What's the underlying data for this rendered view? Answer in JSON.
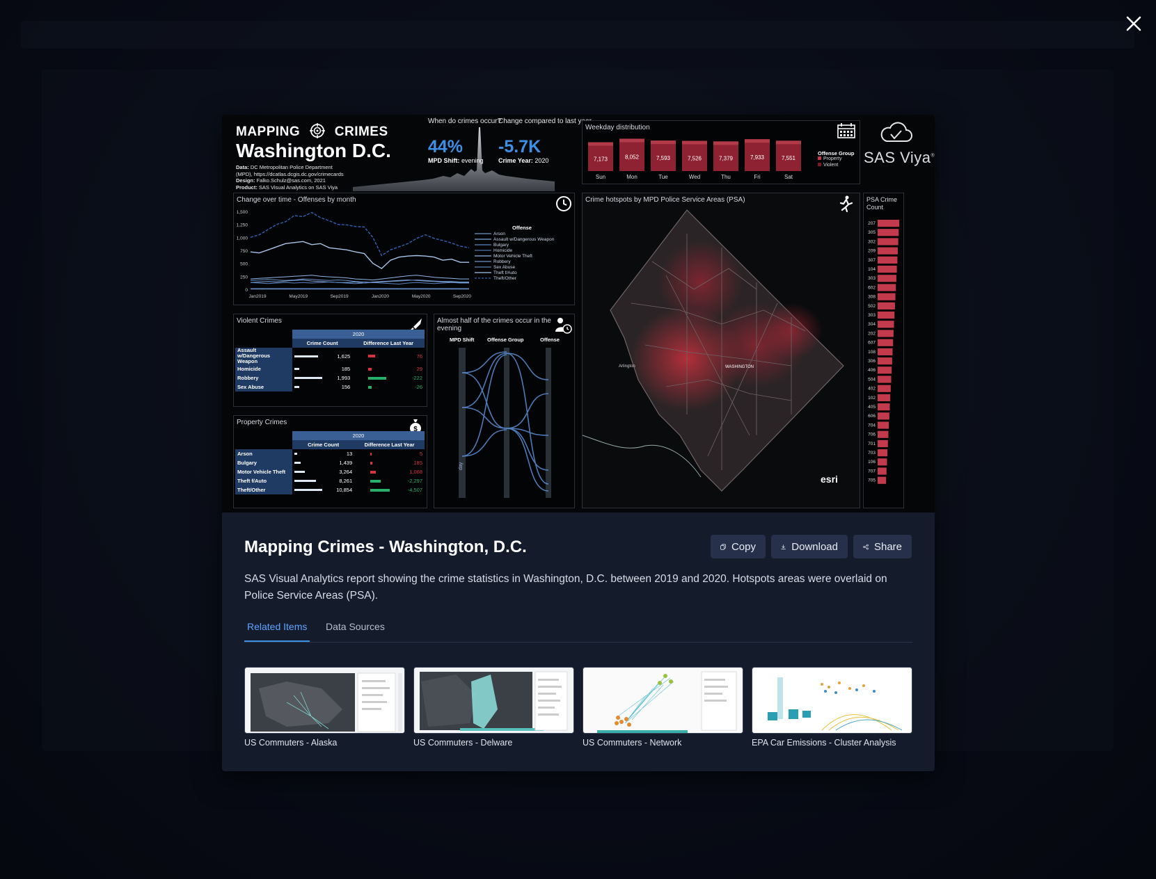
{
  "close": {
    "icon": "close-icon"
  },
  "modal": {
    "title": "Mapping Crimes - Washington, D.C.",
    "description": "SAS Visual Analytics report showing the crime statistics in Washington, D.C. between 2019 and 2020. Hotspots areas were overlaid on Police Service Areas (PSA).",
    "buttons": {
      "copy": "Copy",
      "download": "Download",
      "share": "Share"
    },
    "tabs": [
      {
        "label": "Related Items",
        "active": true
      },
      {
        "label": "Data Sources",
        "active": false
      }
    ],
    "related": [
      {
        "label": "US Commuters - Alaska"
      },
      {
        "label": "US Commuters - Delware"
      },
      {
        "label": "US Commuters - Network"
      },
      {
        "label": "EPA Car Emissions - Cluster Analysis"
      }
    ]
  },
  "dashboard": {
    "header": {
      "mapping": "MAPPING",
      "crimes": "CRIMES",
      "city": "Washington D.C.",
      "info": [
        {
          "label": "Data:",
          "text": " DC Metropolitan Police Department"
        },
        {
          "label": "",
          "text": "(MPD), https://dcatlas.dcgis.dc.gov/crimecards"
        },
        {
          "label": "Design:",
          "text": " Falko.Schulz@sas.com, 2021"
        },
        {
          "label": "Product:",
          "text": " SAS Visual Analytics on SAS Viya"
        }
      ]
    },
    "kpi1": {
      "question": "When do crimes\noccur?",
      "value": "44%",
      "sub_label": "MPD Shift:",
      "sub_value": "evening"
    },
    "kpi2": {
      "question": "Change compared to\nlast year",
      "value": "-5.7K",
      "sub_label": "Crime Year:",
      "sub_value": "2020"
    },
    "weekday": {
      "title": "Weekday distribution",
      "legend_title": "Offense Group",
      "legend": [
        "Property",
        "Violent"
      ]
    },
    "brand": "SAS Viya",
    "brand_mark": "®",
    "change_over_time": {
      "title": "Change over time - Offenses by month"
    },
    "violent": {
      "title": "Violent Crimes",
      "year": "2020",
      "col1": "Crime Count",
      "col2": "Difference Last Year",
      "rows": [
        {
          "name": "Assault w/Dangerous Weapon",
          "count": "1,625",
          "diff": "76",
          "count_frac": 0.82,
          "diff_frac": 0.3,
          "positive": false
        },
        {
          "name": "Homicide",
          "count": "185",
          "diff": "29",
          "count_frac": 0.09,
          "diff_frac": 0.12,
          "positive": false
        },
        {
          "name": "Robbery",
          "count": "1,993",
          "diff": "-222",
          "count_frac": 1.0,
          "diff_frac": 0.9,
          "positive": true
        },
        {
          "name": "Sex Abuse",
          "count": "156",
          "diff": "-26",
          "count_frac": 0.08,
          "diff_frac": 0.11,
          "positive": true
        }
      ]
    },
    "property": {
      "title": "Property Crimes",
      "year": "2020",
      "col1": "Crime Count",
      "col2": "Difference Last Year",
      "rows": [
        {
          "name": "Arson",
          "count": "13",
          "diff": "5",
          "count_frac": 0.01,
          "diff_frac": 0.01,
          "positive": false
        },
        {
          "name": "Bulgary",
          "count": "1,439",
          "diff": "185",
          "count_frac": 0.13,
          "diff_frac": 0.04,
          "positive": false
        },
        {
          "name": "Motor Vehicle Theft",
          "count": "3,264",
          "diff": "1,068",
          "count_frac": 0.3,
          "diff_frac": 0.23,
          "positive": false
        },
        {
          "name": "Theft f/Auto",
          "count": "8,261",
          "diff": "-2,297",
          "count_frac": 0.76,
          "diff_frac": 0.5,
          "positive": true
        },
        {
          "name": "Theft/Other",
          "count": "10,854",
          "diff": "-4,507",
          "count_frac": 1.0,
          "diff_frac": 0.98,
          "positive": true
        }
      ]
    },
    "parallel": {
      "title": "Almost half of the crimes occur in the\nevening",
      "axes": [
        "MPD Shift",
        "Offense Group",
        "Offense"
      ],
      "axis_label": "day"
    },
    "map": {
      "title": "Crime hotspots by MPD Police Service Areas (PSA)",
      "credit": "esri",
      "city_label": "WASHINGTON",
      "arlington": "Arlington"
    },
    "psa": {
      "title": "PSA Crime\nCount"
    }
  },
  "chart_data": [
    {
      "type": "bar",
      "title": "Weekday distribution",
      "categories": [
        "Sun",
        "Mon",
        "Tue",
        "Wed",
        "Thu",
        "Fri",
        "Sat"
      ],
      "series": [
        {
          "name": "Property",
          "values": [
            7173,
            8052,
            7593,
            7526,
            7379,
            7933,
            7551
          ]
        }
      ],
      "value_labels": [
        "7,173",
        "8,052",
        "7,593",
        "7,526",
        "7,379",
        "7,933",
        "7,551"
      ]
    },
    {
      "type": "line",
      "title": "Change over time - Offenses by month",
      "x": [
        "Jan2019",
        "May2019",
        "Sep2019",
        "Jan2020",
        "May2020",
        "Sep2020"
      ],
      "yticks": [
        "0",
        "250",
        "500",
        "750",
        "1,000",
        "1,250",
        "1,500"
      ],
      "ylim": [
        0,
        1500
      ],
      "legend_title": "Offense",
      "series": [
        {
          "name": "Arson",
          "values": [
            3,
            3,
            3,
            3,
            3,
            3,
            3,
            3,
            3,
            3,
            3,
            3,
            3,
            3,
            3,
            3,
            3,
            3,
            3,
            3,
            3,
            3,
            3,
            3,
            3,
            3
          ],
          "style": "solid"
        },
        {
          "name": "Assault w/Dangerous Weapon",
          "values": [
            130,
            140,
            150,
            140,
            160,
            170,
            180,
            160,
            150,
            140,
            130,
            130,
            140,
            120,
            140,
            150,
            160,
            170,
            180,
            170,
            160,
            150,
            140,
            140,
            130,
            130
          ],
          "style": "solid"
        },
        {
          "name": "Bulgary",
          "values": [
            130,
            120,
            110,
            120,
            130,
            120,
            130,
            120,
            130,
            140,
            130,
            120,
            110,
            120,
            130,
            120,
            110,
            100,
            120,
            130,
            120,
            110,
            120,
            130,
            120,
            120
          ],
          "style": "solid"
        },
        {
          "name": "Homicide",
          "values": [
            15,
            15,
            15,
            15,
            15,
            15,
            15,
            15,
            15,
            15,
            15,
            15,
            15,
            15,
            15,
            15,
            15,
            15,
            15,
            15,
            15,
            15,
            15,
            15,
            15,
            15
          ],
          "style": "solid"
        },
        {
          "name": "Motor Vehicle Theft",
          "values": [
            200,
            210,
            220,
            230,
            240,
            250,
            260,
            270,
            250,
            240,
            230,
            220,
            200,
            190,
            180,
            200,
            220,
            240,
            260,
            270,
            250,
            230,
            220,
            210,
            200,
            200
          ],
          "style": "solid"
        },
        {
          "name": "Robbery",
          "values": [
            170,
            180,
            190,
            180,
            170,
            180,
            200,
            190,
            180,
            170,
            180,
            170,
            150,
            140,
            130,
            140,
            150,
            160,
            170,
            180,
            170,
            160,
            150,
            150,
            140,
            140
          ],
          "style": "solid"
        },
        {
          "name": "Sex Abuse",
          "values": [
            10,
            10,
            10,
            10,
            10,
            10,
            10,
            10,
            10,
            10,
            10,
            10,
            10,
            10,
            10,
            10,
            10,
            10,
            10,
            10,
            10,
            10,
            10,
            10,
            10,
            10
          ],
          "style": "solid"
        },
        {
          "name": "Theft f/Auto",
          "values": [
            720,
            700,
            760,
            820,
            880,
            900,
            920,
            860,
            880,
            800,
            780,
            760,
            720,
            690,
            500,
            400,
            560,
            620,
            640,
            650,
            640,
            620,
            560,
            580,
            520,
            520
          ],
          "style": "solid"
        },
        {
          "name": "Theft/Other",
          "values": [
            1000,
            1050,
            1150,
            1250,
            1300,
            1420,
            1400,
            1480,
            1380,
            1320,
            1250,
            1240,
            1210,
            1200,
            1000,
            650,
            760,
            820,
            880,
            980,
            1050,
            980,
            940,
            890,
            830,
            800
          ],
          "style": "dashed"
        }
      ]
    },
    {
      "type": "bar",
      "title": "PSA Crime\nCount",
      "categories": [
        "207",
        "305",
        "302",
        "209",
        "307",
        "104",
        "303",
        "602",
        "308",
        "502",
        "303",
        "304",
        "202",
        "607",
        "108",
        "306",
        "406",
        "504",
        "402",
        "102",
        "405",
        "606",
        "704",
        "706",
        "701",
        "703",
        "106",
        "707",
        "705"
      ],
      "values": [
        1850,
        1800,
        1760,
        1720,
        1690,
        1640,
        1600,
        1560,
        1520,
        1480,
        1440,
        1400,
        1360,
        1320,
        1280,
        1240,
        1200,
        1160,
        1120,
        1080,
        1040,
        1000,
        960,
        920,
        880,
        840,
        800,
        760,
        720
      ]
    }
  ]
}
